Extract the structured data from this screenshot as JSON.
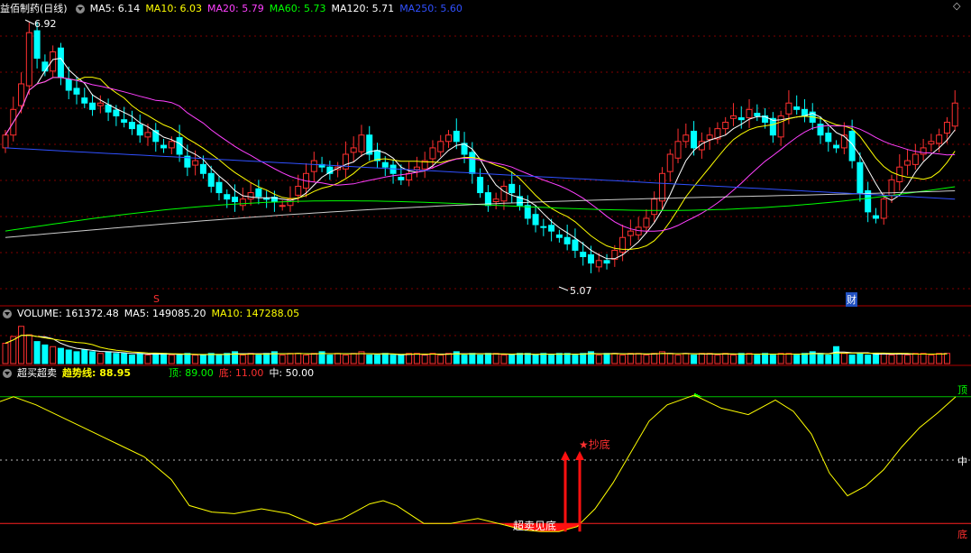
{
  "main_panel": {
    "stock_title": "益佰制药(日线)",
    "ma_labels": [
      {
        "text": "MA5: 6.14",
        "color": "#ffffff"
      },
      {
        "text": "MA10: 6.03",
        "color": "#ffff00"
      },
      {
        "text": "MA20: 5.79",
        "color": "#ff40ff"
      },
      {
        "text": "MA60: 5.73",
        "color": "#00ff00"
      },
      {
        "text": "MA120: 5.71",
        "color": "#ffffff"
      },
      {
        "text": "MA250: 5.60",
        "color": "#3050ff"
      }
    ],
    "high_label": "6.92",
    "low_label": "5.07",
    "marker_s": "S",
    "marker_cai": "财"
  },
  "volume_panel": {
    "title": "VOLUME: 161372.48",
    "ma5": "MA5: 149085.20",
    "ma10": "MA10: 147288.05"
  },
  "indicator_panel": {
    "title": "超买超卖",
    "trend_label": "趋势线: 88.95",
    "top": "顶: 89.00",
    "bottom": "底: 11.00",
    "mid": "中: 50.00",
    "right_top": "顶",
    "right_mid": "中",
    "right_bottom": "底",
    "buy_label": "★抄底",
    "oversold_label": "超卖见底"
  },
  "chart_data": [
    {
      "type": "candlestick",
      "price_range": [
        4.9,
        7.0
      ],
      "closes": [
        6.1,
        6.3,
        6.5,
        6.9,
        6.7,
        6.6,
        6.75,
        6.55,
        6.45,
        6.42,
        6.35,
        6.3,
        6.35,
        6.28,
        6.25,
        6.2,
        6.15,
        6.1,
        6.12,
        6.05,
        6.0,
        6.05,
        5.95,
        5.85,
        5.9,
        5.8,
        5.7,
        5.65,
        5.6,
        5.58,
        5.6,
        5.65,
        5.62,
        5.6,
        5.58,
        5.55,
        5.6,
        5.7,
        5.8,
        5.9,
        5.85,
        5.8,
        5.85,
        5.95,
        6.0,
        6.1,
        5.95,
        5.9,
        5.85,
        5.8,
        5.75,
        5.8,
        5.85,
        5.9,
        6.0,
        6.05,
        6.1,
        6.05,
        5.95,
        5.8,
        5.65,
        5.55,
        5.6,
        5.7,
        5.65,
        5.55,
        5.45,
        5.4,
        5.38,
        5.35,
        5.3,
        5.25,
        5.2,
        5.15,
        5.1,
        5.12,
        5.1,
        5.2,
        5.3,
        5.35,
        5.38,
        5.45,
        5.6,
        5.8,
        5.95,
        6.05,
        6.1,
        6.0,
        6.05,
        6.1,
        6.15,
        6.2,
        6.25,
        6.22,
        6.3,
        6.25,
        6.2,
        6.1,
        6.25,
        6.35,
        6.3,
        6.25,
        6.2,
        6.1,
        6.05,
        6.0,
        6.1,
        5.9,
        5.65,
        5.5,
        5.45,
        5.6,
        5.75,
        5.85,
        5.9,
        5.95,
        6.0,
        6.05,
        6.1,
        6.2,
        6.35
      ]
    },
    {
      "type": "bar",
      "name": "VOLUME",
      "values": [
        1.2,
        1.6,
        2.2,
        1.7,
        1.3,
        1.1,
        1.0,
        0.9,
        0.8,
        0.7,
        0.8,
        0.7,
        0.6,
        0.7,
        0.6,
        0.6,
        0.5,
        0.6,
        0.5,
        0.6,
        0.6,
        0.5,
        0.5,
        0.6,
        0.5,
        0.5,
        0.6,
        0.5,
        0.6,
        0.7,
        0.5,
        0.6,
        0.5,
        0.6,
        0.7,
        0.5,
        0.6,
        0.6,
        0.5,
        0.6,
        0.7,
        0.5,
        0.6,
        0.5,
        0.6,
        0.7,
        0.5,
        0.5,
        0.6,
        0.5,
        0.5,
        0.6,
        0.6,
        0.5,
        0.6,
        0.5,
        0.6,
        0.7,
        0.5,
        0.6,
        0.5,
        0.6,
        0.6,
        0.5,
        0.5,
        0.6,
        0.6,
        0.5,
        0.6,
        0.5,
        0.6,
        0.6,
        0.5,
        0.6,
        0.7,
        0.5,
        0.6,
        0.6,
        0.5,
        0.6,
        0.6,
        0.5,
        0.6,
        0.7,
        0.6,
        0.5,
        0.6,
        0.5,
        0.6,
        0.6,
        0.5,
        0.6,
        0.5,
        0.6,
        0.6,
        0.5,
        0.6,
        0.5,
        0.6,
        0.6,
        0.5,
        0.6,
        0.7,
        0.6,
        0.5,
        1.0,
        0.6,
        0.5,
        0.6,
        0.5,
        0.6,
        0.6,
        0.5,
        0.6,
        0.5,
        0.6,
        0.6,
        0.5,
        0.6,
        0.6
      ]
    },
    {
      "type": "line",
      "name": "趋势线",
      "ylim": [
        0,
        100
      ],
      "reference_lines": [
        89,
        50,
        11
      ],
      "x": [
        0,
        15,
        40,
        70,
        100,
        130,
        160,
        190,
        210,
        235,
        260,
        290,
        320,
        350,
        380,
        410,
        425,
        440,
        470,
        500,
        530,
        560,
        580,
        600,
        620,
        640,
        660,
        680,
        700,
        720,
        740,
        770,
        800,
        830,
        860,
        880,
        900,
        920,
        940,
        960,
        980,
        1000,
        1020,
        1040,
        1060
      ],
      "values": [
        86,
        89,
        84,
        76,
        68,
        60,
        52,
        38,
        22,
        18,
        17,
        20,
        17,
        10,
        14,
        23,
        25,
        22,
        11,
        11,
        14,
        10,
        7,
        6,
        6,
        9,
        20,
        36,
        55,
        74,
        84,
        90,
        82,
        78,
        87,
        80,
        66,
        42,
        28,
        34,
        44,
        58,
        70,
        79,
        88.95
      ]
    }
  ]
}
